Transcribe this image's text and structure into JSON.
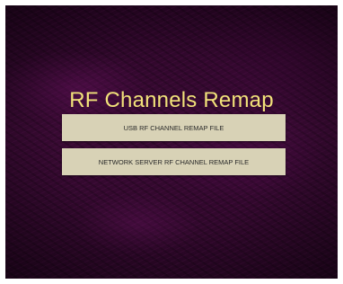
{
  "screen": {
    "title": "RF Channels Remap"
  },
  "buttons": {
    "usb_label": "USB RF CHANNEL REMAP FILE",
    "network_label": "NETWORK SERVER RF CHANNEL REMAP FILE"
  },
  "colors": {
    "background": "#3a0a34",
    "title": "#f2e27a",
    "button_bg": "#d8d2b6",
    "button_text": "#2a2a2a"
  }
}
